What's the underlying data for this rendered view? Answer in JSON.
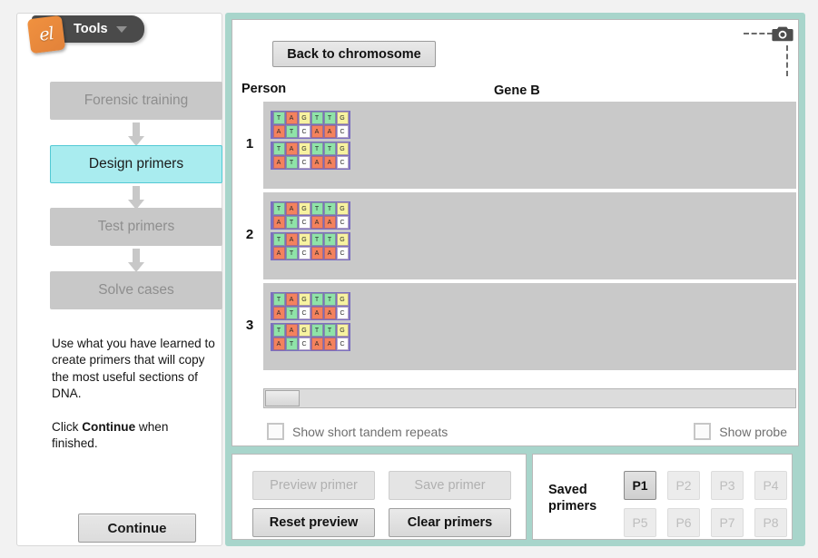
{
  "app": {
    "logo_glyph": "el",
    "tools_label": "Tools",
    "tools_caret": "chevron-down-icon"
  },
  "sidebar": {
    "steps": [
      {
        "label": "Forensic training",
        "state": "disabled"
      },
      {
        "label": "Design primers",
        "state": "active"
      },
      {
        "label": "Test primers",
        "state": "disabled"
      },
      {
        "label": "Solve cases",
        "state": "disabled"
      }
    ],
    "instructions": {
      "paragraph1": "Use what you have learned to create primers that will copy the most useful sections of DNA.",
      "click_prefix": "Click ",
      "click_bold": "Continue",
      "click_suffix": " when finished."
    },
    "continue_label": "Continue"
  },
  "stage": {
    "back_button": "Back to chromosome",
    "camera_icon": "camera-icon",
    "person_header": "Person",
    "gene_header": "Gene B",
    "persons": [
      {
        "number": "1",
        "strands": [
          {
            "top": "TAGTTG",
            "bottom": "ATCAAC"
          },
          {
            "top": "TAGTTG",
            "bottom": "ATCAAC"
          }
        ]
      },
      {
        "number": "2",
        "strands": [
          {
            "top": "TAGTTG",
            "bottom": "ATCAAC"
          },
          {
            "top": "TAGTTG",
            "bottom": "ATCAAC"
          }
        ]
      },
      {
        "number": "3",
        "strands": [
          {
            "top": "TAGTTG",
            "bottom": "ATCAAC"
          },
          {
            "top": "TAGTTG",
            "bottom": "ATCAAC"
          }
        ]
      }
    ],
    "checkboxes": [
      {
        "label": "Show short tandem repeats",
        "checked": false
      },
      {
        "label": "Show probe",
        "checked": false
      }
    ]
  },
  "controls": {
    "buttons": [
      {
        "label": "Preview primer",
        "state": "disabled"
      },
      {
        "label": "Save primer",
        "state": "disabled"
      },
      {
        "label": "Reset preview",
        "state": "enabled"
      },
      {
        "label": "Clear primers",
        "state": "enabled"
      }
    ],
    "saved_primers": {
      "label_line1": "Saved",
      "label_line2": "primers",
      "slots": [
        {
          "label": "P1",
          "state": "active"
        },
        {
          "label": "P2",
          "state": "inactive"
        },
        {
          "label": "P3",
          "state": "inactive"
        },
        {
          "label": "P4",
          "state": "inactive"
        },
        {
          "label": "P5",
          "state": "inactive"
        },
        {
          "label": "P6",
          "state": "inactive"
        },
        {
          "label": "P7",
          "state": "inactive"
        },
        {
          "label": "P8",
          "state": "inactive"
        }
      ]
    }
  },
  "colors": {
    "panel_frame": "#a8d5cb",
    "active_step": "#a9ecef",
    "disabled_step": "#c8c8c8",
    "row_background": "#c9c9c9",
    "backbone": "#7b6fc0",
    "base_T": "#8fe3a8",
    "base_A": "#f4825d",
    "base_G": "#f7f2a0",
    "base_C": "#fdfdfd",
    "logo_orange": "#e2823a"
  }
}
